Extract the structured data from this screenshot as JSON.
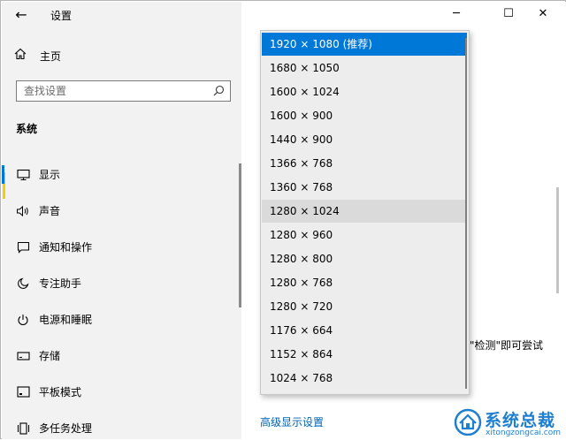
{
  "window": {
    "title": "设置",
    "back_glyph": "←",
    "minimize_glyph": "─",
    "maximize_glyph": "☐",
    "close_glyph": "✕"
  },
  "sidebar": {
    "home_label": "主页",
    "search_placeholder": "查找设置",
    "section_title": "系统",
    "items": [
      {
        "label": "显示",
        "icon": "monitor-icon"
      },
      {
        "label": "声音",
        "icon": "speaker-icon"
      },
      {
        "label": "通知和操作",
        "icon": "notification-icon"
      },
      {
        "label": "专注助手",
        "icon": "moon-icon"
      },
      {
        "label": "电源和睡眠",
        "icon": "power-icon"
      },
      {
        "label": "存储",
        "icon": "storage-icon"
      },
      {
        "label": "平板模式",
        "icon": "tablet-icon"
      },
      {
        "label": "多任务处理",
        "icon": "multitask-icon"
      }
    ]
  },
  "main": {
    "advanced_link": "高级显示设置",
    "partial_text": "\"检测\"即可尝试"
  },
  "resolution_dropdown": {
    "options": [
      "1920 × 1080 (推荐)",
      "1680 × 1050",
      "1600 × 1024",
      "1600 × 900",
      "1440 × 900",
      "1366 × 768",
      "1360 × 768",
      "1280 × 1024",
      "1280 × 960",
      "1280 × 800",
      "1280 × 768",
      "1280 × 720",
      "1176 × 664",
      "1152 × 864",
      "1024 × 768"
    ],
    "selected": "1920 × 1080 (推荐)",
    "hovered": "1280 × 1024"
  },
  "watermark": {
    "title": "系统总裁",
    "subtitle": "xitongzongcai.com"
  },
  "colors": {
    "accent": "#0078d7",
    "sidebar_bg": "#f2f2f2",
    "link": "#0063b1",
    "watermark": "#1e7fd0"
  }
}
